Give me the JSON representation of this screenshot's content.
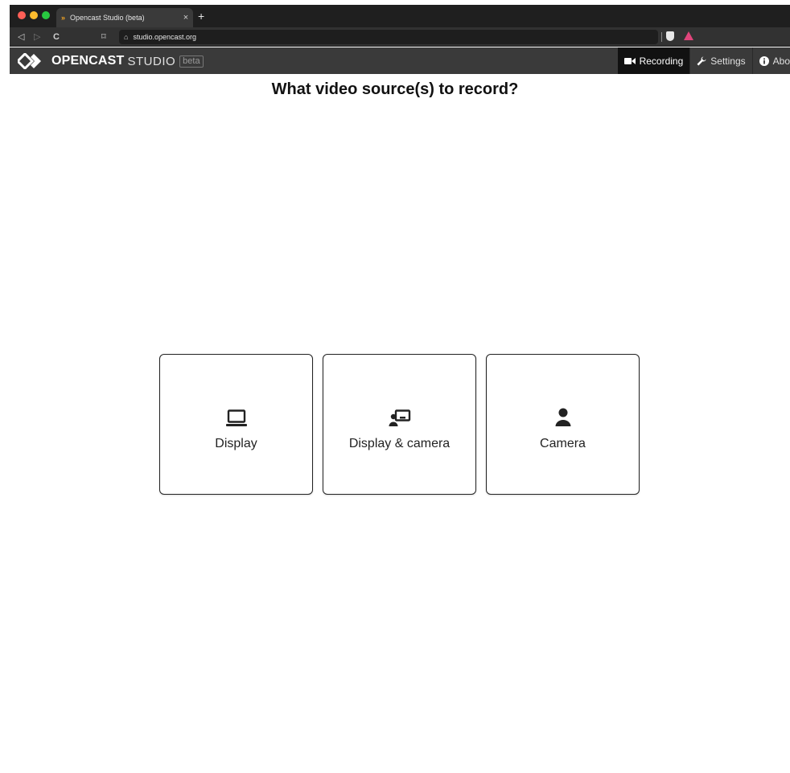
{
  "browser": {
    "tab_title": "Opencast Studio (beta)",
    "tab_close": "×",
    "new_tab": "+",
    "url": "studio.opencast.org"
  },
  "app": {
    "brand_primary": "OPENCAST",
    "brand_secondary": "STUDIO",
    "brand_badge": "beta",
    "nav": [
      {
        "label": "Recording",
        "icon": "video-camera-icon",
        "active": true
      },
      {
        "label": "Settings",
        "icon": "wrench-icon",
        "active": false
      },
      {
        "label": "Abo",
        "icon": "info-icon",
        "active": false
      }
    ]
  },
  "main": {
    "heading": "What video source(s) to record?",
    "sources": [
      {
        "label": "Display",
        "icon": "monitor-icon"
      },
      {
        "label": "Display & camera",
        "icon": "display-camera-icon"
      },
      {
        "label": "Camera",
        "icon": "person-icon"
      }
    ]
  },
  "colors": {
    "header_bg": "#3a3a3a",
    "active_tab_bg": "#111111",
    "card_border": "#222222"
  }
}
